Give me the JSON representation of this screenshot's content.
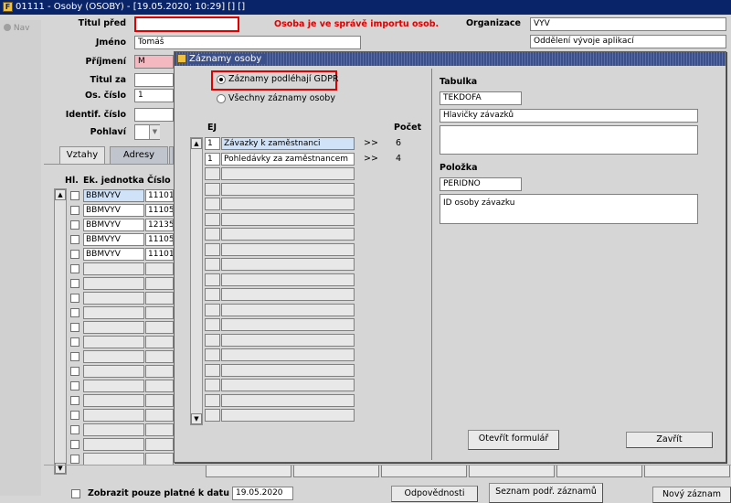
{
  "window": {
    "title": "01111 - Osoby (OSOBY) - [19.05.2020; 10:29] [] []"
  },
  "left_nav": {
    "label": "Nav"
  },
  "form": {
    "titul_pred_label": "Titul před",
    "titul_pred_value": "",
    "import_warning": "Osoba je ve správě importu osob.",
    "organizace_label": "Organizace",
    "organizace_value": "VYV",
    "organizace_desc": "Oddělení vývoje aplikací",
    "jmeno_label": "Jméno",
    "jmeno_value": "Tomáš",
    "prijmeni_label": "Příjmení",
    "prijmeni_value": "M",
    "titul_za_label": "Titul za",
    "os_cislo_label": "Os. číslo",
    "os_cislo_value": "1",
    "identif_label": "Identif. číslo",
    "pohlavi_label": "Pohlaví"
  },
  "tabs": [
    {
      "label": "Vztahy"
    },
    {
      "label": "Adresy"
    }
  ],
  "grid": {
    "col_hl": "Hl.",
    "col_ek": "Ek. jednotka",
    "col_cislo": "Číslo",
    "rows": [
      {
        "ek": "BBMVYV",
        "cislo": "11101"
      },
      {
        "ek": "BBMVYV",
        "cislo": "11105"
      },
      {
        "ek": "BBMVYV",
        "cislo": "12135"
      },
      {
        "ek": "BBMVYV",
        "cislo": "11105"
      },
      {
        "ek": "BBMVYV",
        "cislo": "11101"
      }
    ]
  },
  "footer": {
    "platne_label": "Zobrazit pouze platné k datu :",
    "platne_date": "19.05.2020",
    "odpovednosti": "Odpovědnosti",
    "seznam": "Seznam podř. záznamů",
    "novy": "Nový záznam"
  },
  "dialog": {
    "title": "Záznamy osoby",
    "radio_gdpr": "Záznamy podléhají GDPR",
    "radio_all": "Všechny záznamy osoby",
    "col_ej": "EJ",
    "col_pocet": "Počet",
    "rows": [
      {
        "ej": "1",
        "name": "Závazky k zaměstnanci",
        "arrow": ">>",
        "count": "6"
      },
      {
        "ej": "1",
        "name": "Pohledávky za zaměstnancem",
        "arrow": ">>",
        "count": "4"
      }
    ],
    "tabulka_label": "Tabulka",
    "tabulka_value": "TEKDOFA",
    "tabulka_desc": "Hlavičky závazků",
    "polozka_label": "Položka",
    "polozka_value": "PERIDNO",
    "polozka_desc": "ID osoby závazku",
    "open_button": "Otevřít formulář",
    "close_button": "Zavřít"
  }
}
